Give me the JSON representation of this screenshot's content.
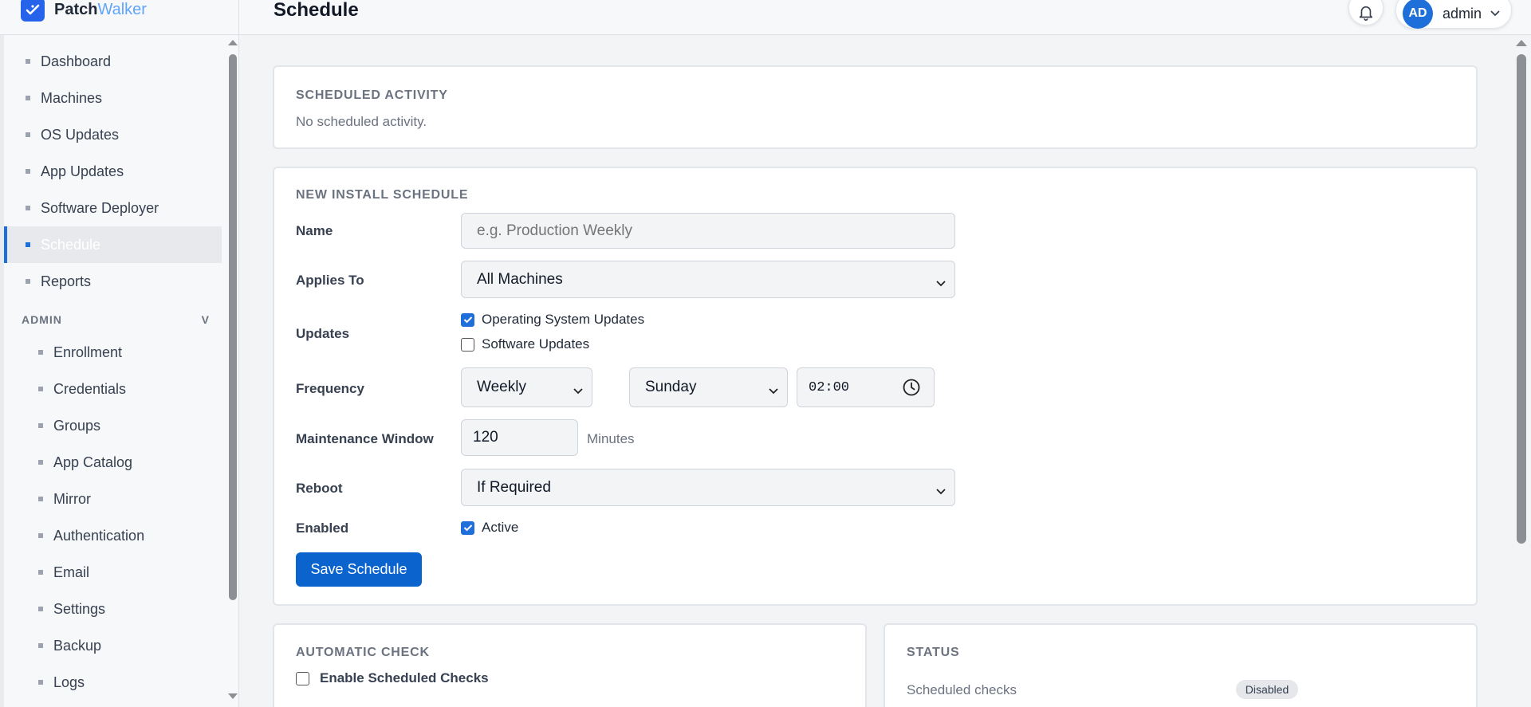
{
  "brand": {
    "name_part1": "Patch",
    "name_part2": "Walker"
  },
  "header": {
    "title": "Schedule",
    "user": {
      "initials": "AD",
      "name": "admin"
    }
  },
  "sidebar": {
    "items": [
      {
        "label": "Dashboard"
      },
      {
        "label": "Machines"
      },
      {
        "label": "OS Updates"
      },
      {
        "label": "App Updates"
      },
      {
        "label": "Software Deployer"
      },
      {
        "label": "Schedule",
        "active": true
      },
      {
        "label": "Reports"
      }
    ],
    "admin_section": {
      "label": "ADMIN",
      "toggle": "V"
    },
    "admin_items": [
      {
        "label": "Enrollment"
      },
      {
        "label": "Credentials"
      },
      {
        "label": "Groups"
      },
      {
        "label": "App Catalog"
      },
      {
        "label": "Mirror"
      },
      {
        "label": "Authentication"
      },
      {
        "label": "Email"
      },
      {
        "label": "Settings"
      },
      {
        "label": "Backup"
      },
      {
        "label": "Logs"
      }
    ]
  },
  "scheduled_activity": {
    "title": "SCHEDULED ACTIVITY",
    "empty_text": "No scheduled activity."
  },
  "new_schedule": {
    "title": "NEW INSTALL SCHEDULE",
    "name": {
      "label": "Name",
      "value": "",
      "placeholder": "e.g. Production Weekly"
    },
    "applies_to": {
      "label": "Applies To",
      "value": "All Machines"
    },
    "updates": {
      "label": "Updates",
      "options": [
        {
          "label": "Operating System Updates",
          "checked": true
        },
        {
          "label": "Software Updates",
          "checked": false
        }
      ]
    },
    "frequency": {
      "label": "Frequency",
      "interval": "Weekly",
      "day": "Sunday",
      "time": "02:00"
    },
    "maintenance_window": {
      "label": "Maintenance Window",
      "value": "120",
      "unit": "Minutes"
    },
    "reboot": {
      "label": "Reboot",
      "value": "If Required"
    },
    "enabled": {
      "label": "Enabled",
      "option_label": "Active",
      "checked": true
    },
    "save_label": "Save Schedule"
  },
  "automatic_check": {
    "title": "AUTOMATIC CHECK",
    "option_label": "Enable Scheduled Checks",
    "checked": false
  },
  "status": {
    "title": "STATUS",
    "rows": [
      {
        "label": "Scheduled checks",
        "value": "Disabled"
      }
    ]
  },
  "colors": {
    "accent": "#1e6fd9",
    "primary_button": "#0b63ce",
    "brand_light": "#60a5fa"
  }
}
